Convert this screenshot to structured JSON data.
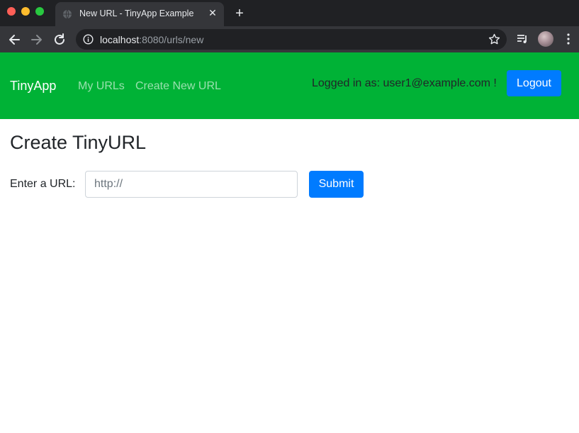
{
  "browser": {
    "tab_title": "New URL - TinyApp Example",
    "tab_close": "✕",
    "new_tab": "+",
    "url_host": "localhost",
    "url_rest": ":8080/urls/new",
    "icons": [
      "back-arrow-icon",
      "forward-arrow-icon",
      "reload-icon",
      "info-icon",
      "star-icon",
      "media-controls-icon",
      "avatar",
      "menu-icon"
    ]
  },
  "navbar": {
    "brand": "TinyApp",
    "links": [
      "My URLs",
      "Create New URL"
    ],
    "logged_in_text": "Logged in as: user1@example.com !",
    "logout_label": "Logout",
    "background": "#00b236"
  },
  "main": {
    "title": "Create TinyURL",
    "url_label": "Enter a URL:",
    "url_placeholder": "http://",
    "submit_label": "Submit",
    "accent": "#007bff"
  }
}
